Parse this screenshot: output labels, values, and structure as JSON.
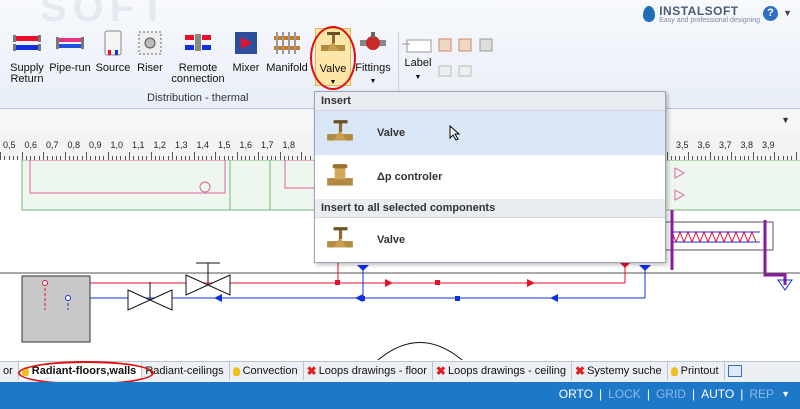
{
  "ribbon": {
    "buttons": [
      {
        "id": "supply-return",
        "line1": "Supply",
        "line2": "Return"
      },
      {
        "id": "pipe-run",
        "line1": "Pipe-run",
        "line2": ""
      },
      {
        "id": "source",
        "line1": "Source",
        "line2": ""
      },
      {
        "id": "riser",
        "line1": "Riser",
        "line2": ""
      },
      {
        "id": "remote-connection",
        "line1": "Remote",
        "line2": "connection"
      },
      {
        "id": "mixer",
        "line1": "Mixer",
        "line2": ""
      },
      {
        "id": "manifold",
        "line1": "Manifold",
        "line2": ""
      },
      {
        "id": "valve",
        "line1": "Valve",
        "line2": ""
      },
      {
        "id": "fittings",
        "line1": "Fittings",
        "line2": ""
      },
      {
        "id": "label",
        "line1": "Label",
        "line2": ""
      }
    ],
    "group_label": "Distribution - thermal",
    "brand": "INSTALSOFT",
    "tagline": "Easy and professional designing",
    "help": "?"
  },
  "ruler": {
    "ticks": [
      "0,5",
      "0,6",
      "0,7",
      "0,8",
      "0,9",
      "1,0",
      "1,1",
      "1,2",
      "1,3",
      "1,4",
      "1,5",
      "1,6",
      "1,7",
      "1,8",
      "3,5",
      "3,6",
      "3,7",
      "3,8",
      "3,9"
    ]
  },
  "menu": {
    "section1": "Insert",
    "item1": "Valve",
    "item2": "Δp controler",
    "section2": "Insert to all selected components",
    "item3": "Valve"
  },
  "tabs": [
    {
      "label": "or",
      "icon": "none"
    },
    {
      "label": "Radiant-floors,walls",
      "icon": "bulb",
      "active": true
    },
    {
      "label": "Radiant-ceilings",
      "icon": "none"
    },
    {
      "label": "Convection",
      "icon": "bulb"
    },
    {
      "label": "Loops drawings - floor",
      "icon": "x"
    },
    {
      "label": "Loops drawings - ceiling",
      "icon": "x"
    },
    {
      "label": "Systemy suche",
      "icon": "x"
    },
    {
      "label": "Printout",
      "icon": "bulb"
    }
  ],
  "status": {
    "orto": "ORTO",
    "lock": "LOCK",
    "grid": "GRID",
    "auto": "AUTO",
    "rep": "REP",
    "sep": "|"
  },
  "colors": {
    "supply": "#e8102a",
    "return": "#1030e0",
    "status_bar": "#1e78c8",
    "highlight": "#e01010"
  }
}
